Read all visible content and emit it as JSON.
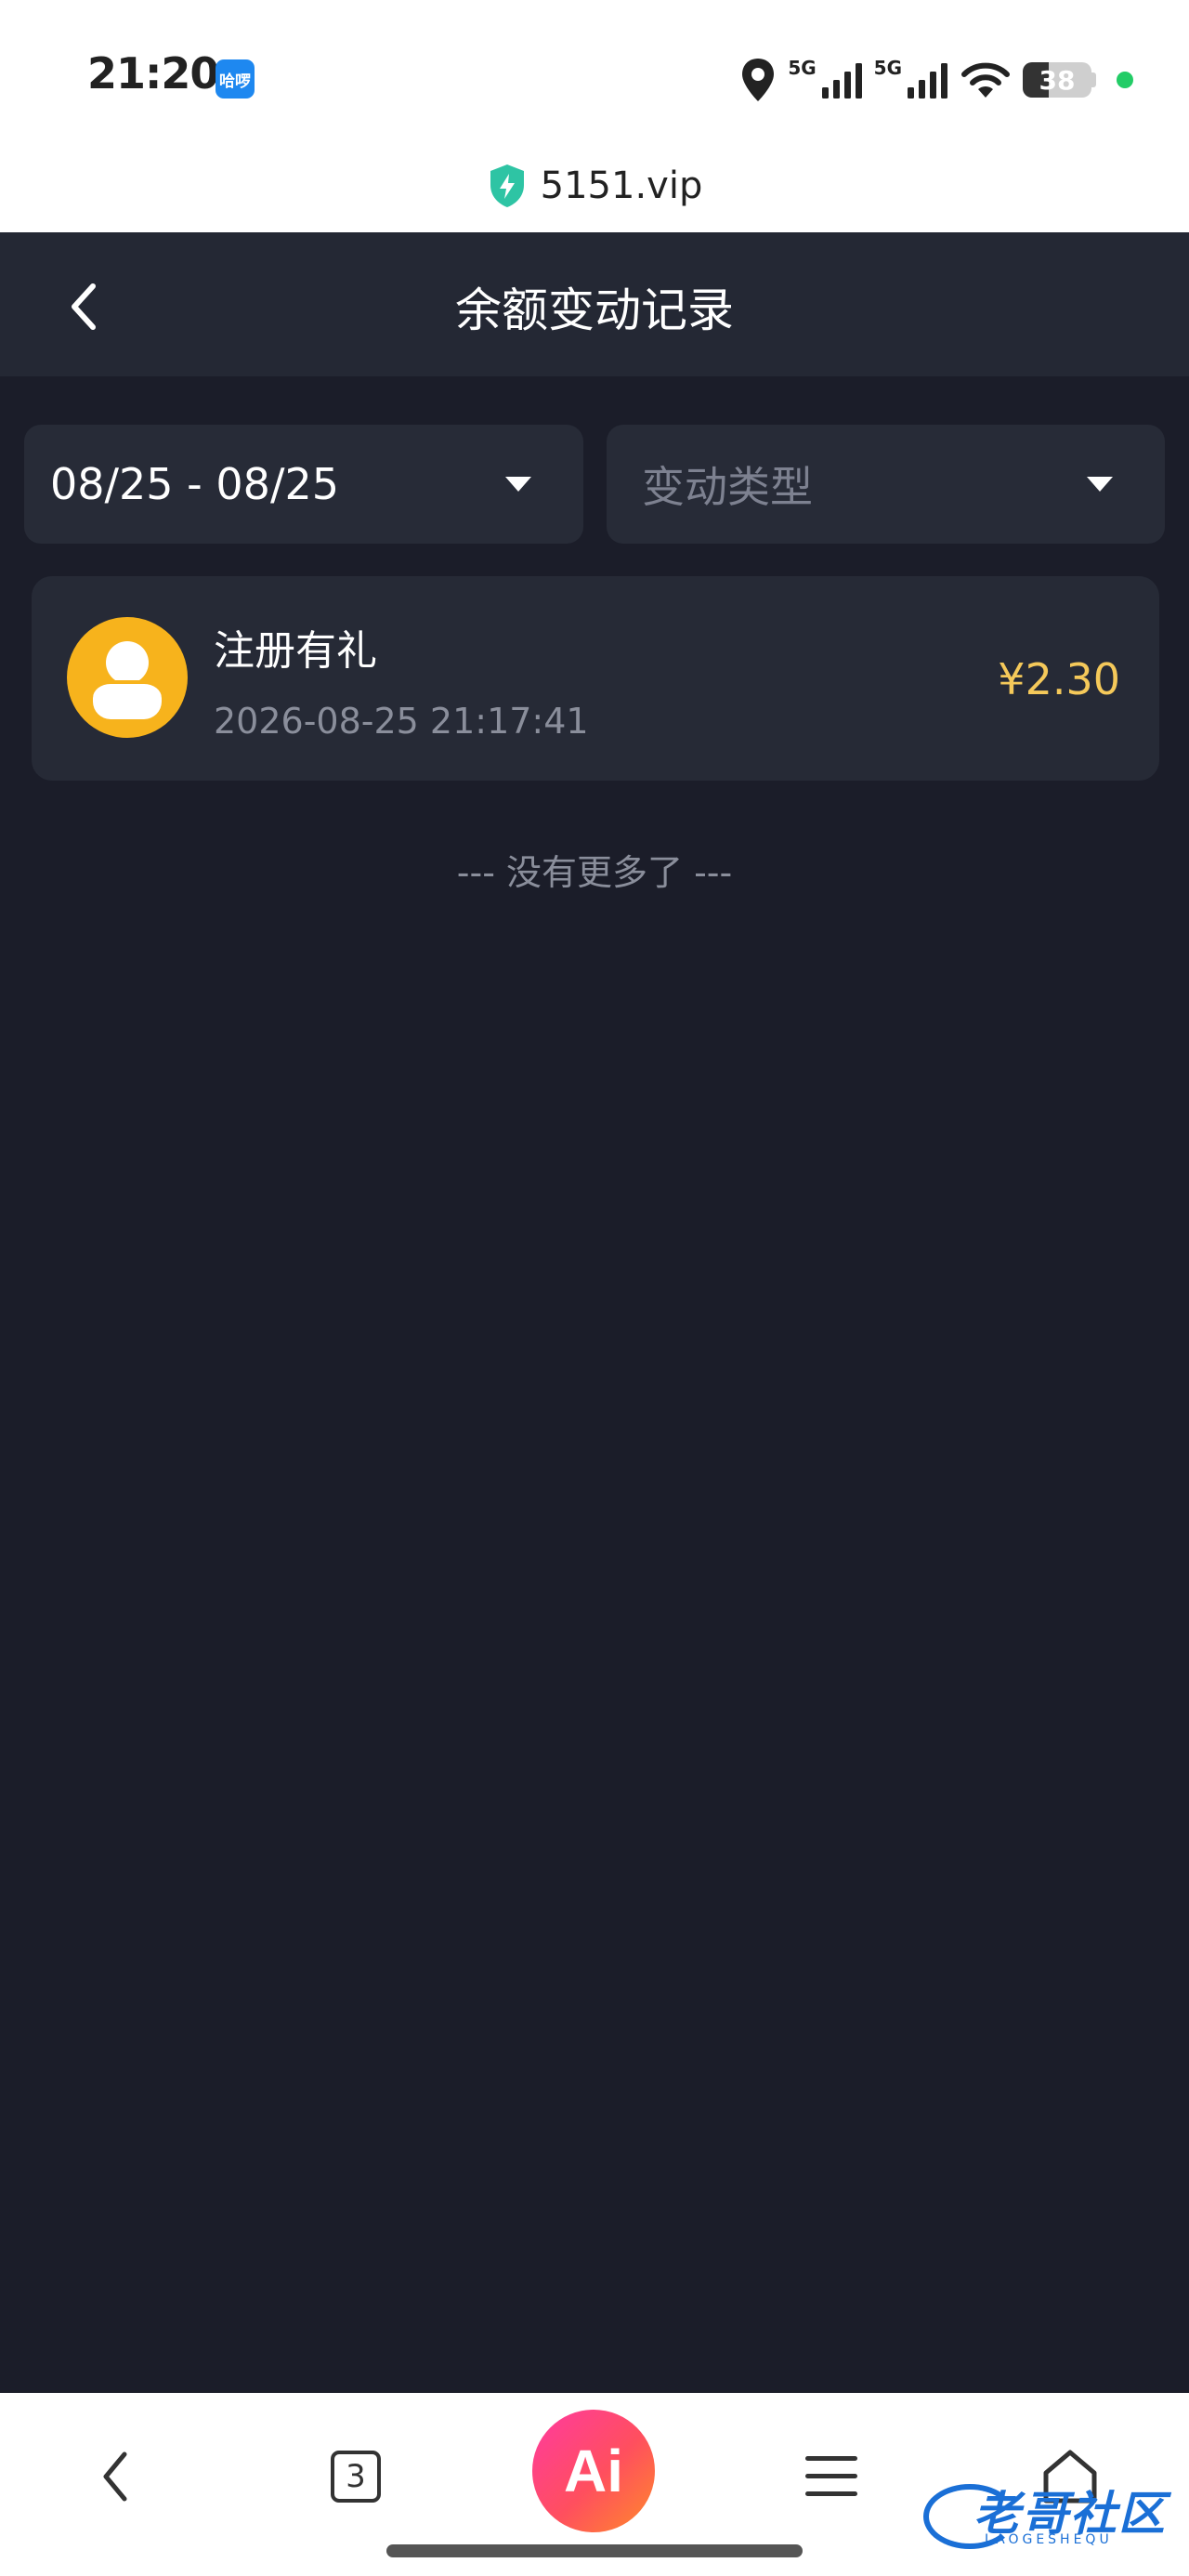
{
  "status_bar": {
    "time": "21:20",
    "app_icon_text": "哈啰",
    "network_1": "5G",
    "network_2": "5G",
    "battery": "38"
  },
  "url_bar": {
    "domain": "5151.vip"
  },
  "header": {
    "title": "余额变动记录"
  },
  "filters": {
    "date_range": "08/25 - 08/25",
    "type_placeholder": "变动类型"
  },
  "records": [
    {
      "title": "注册有礼",
      "time": "2026-08-25 21:17:41",
      "amount": "¥2.30"
    }
  ],
  "list_end": "--- 没有更多了 ---",
  "browser_nav": {
    "tab_count": "3",
    "ai_label": "Ai"
  },
  "watermark": {
    "main": "老哥社区",
    "sub": "LAOGESHEQU"
  },
  "icons": {
    "back": "chevron-left-icon",
    "caret": "caret-down-icon",
    "avatar": "user-avatar-icon",
    "shield": "shield-bolt-icon",
    "location": "location-pin-icon",
    "signal": "cell-signal-icon",
    "wifi": "wifi-icon",
    "menu": "hamburger-menu-icon",
    "home": "home-icon"
  },
  "colors": {
    "page_bg": "#1b1d29",
    "header_bg": "#242834",
    "card_bg": "#262a36",
    "amount": "#f5c95a",
    "avatar": "#f7b31c",
    "shield": "#2ec4a4",
    "ai_gradient_start": "#ff3aa0",
    "ai_gradient_end": "#ff8a2a"
  }
}
